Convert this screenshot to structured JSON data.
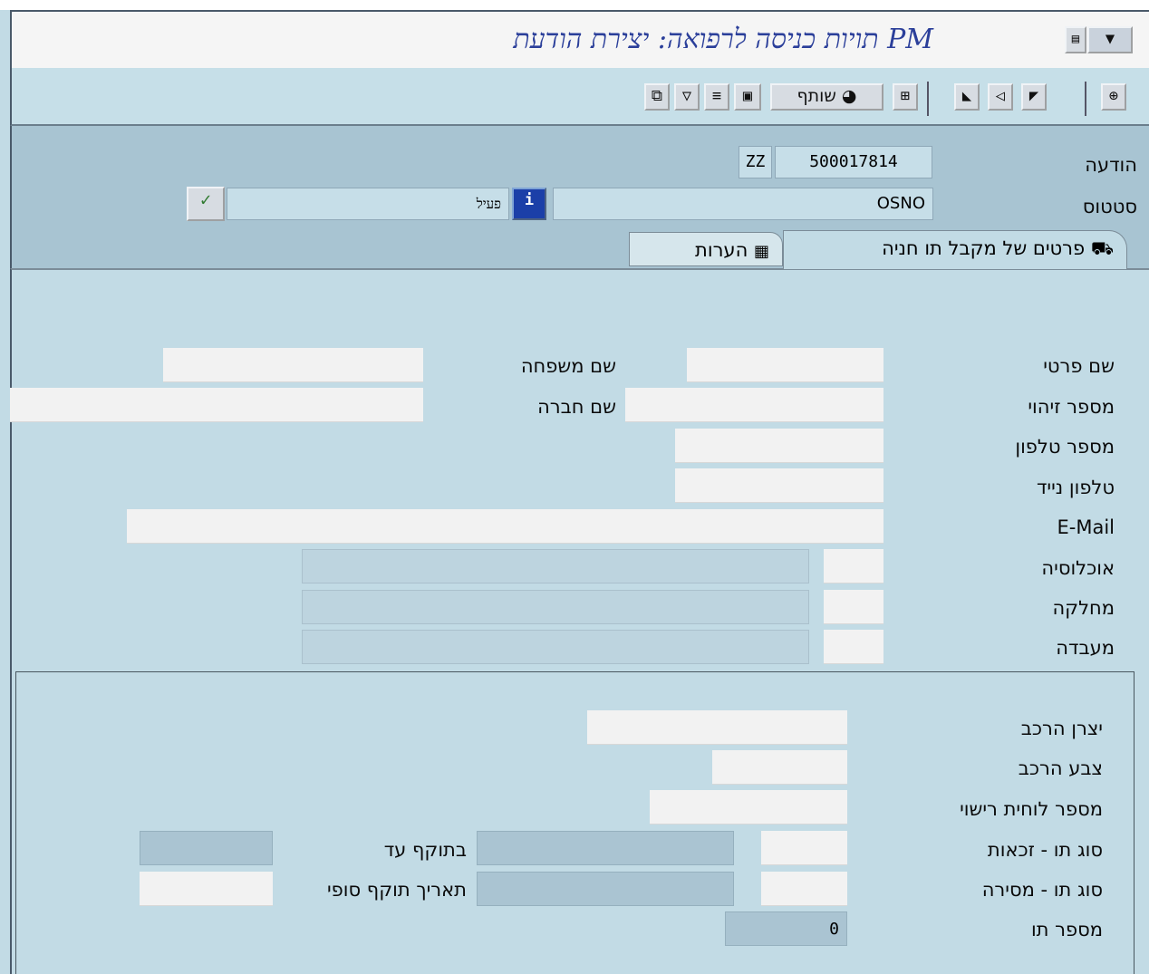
{
  "window": {
    "title": "תויות כניסה לרפואה: יצירת הודעת PM"
  },
  "toolbar": {
    "share_label": "שותף"
  },
  "header": {
    "notification_label": "הודעה",
    "notification_number": "500017814",
    "notification_type": "ZZ",
    "status_label": "סטטוס",
    "status_value": "OSNO",
    "status_text": "פעיל"
  },
  "tabs": [
    {
      "label": "פרטים של מקבל תו חניה",
      "active": true,
      "icon": "car-icon"
    },
    {
      "label": "הערות",
      "active": false,
      "icon": "notes-icon"
    }
  ],
  "form": {
    "first_name_label": "שם פרטי",
    "last_name_label": "שם משפחה",
    "id_number_label": "מספר זיהוי",
    "company_name_label": "שם חברה",
    "phone_label": "מספר טלפון",
    "mobile_label": "טלפון נייד",
    "email_label": "E-Mail",
    "population_label": "אוכלוסיה",
    "department_label": "מחלקה",
    "lab_label": "מעבדה"
  },
  "vehicle": {
    "manufacturer_label": "יצרן הרכב",
    "color_label": "צבע הרכב",
    "plate_label": "מספר לוחית רישוי",
    "permit_type_label": "סוג תו - זכאות",
    "valid_until_label": "בתוקף עד",
    "delivery_type_label": "סוג תו - מסירה",
    "final_date_label": "תאריך תוקף סופי",
    "permit_number_label": "מספר תו",
    "permit_number_value": "0"
  },
  "colors": {
    "title_text": "#2b3f9a",
    "background": "#c2dbe5",
    "header_band": "#a8c4d2"
  }
}
